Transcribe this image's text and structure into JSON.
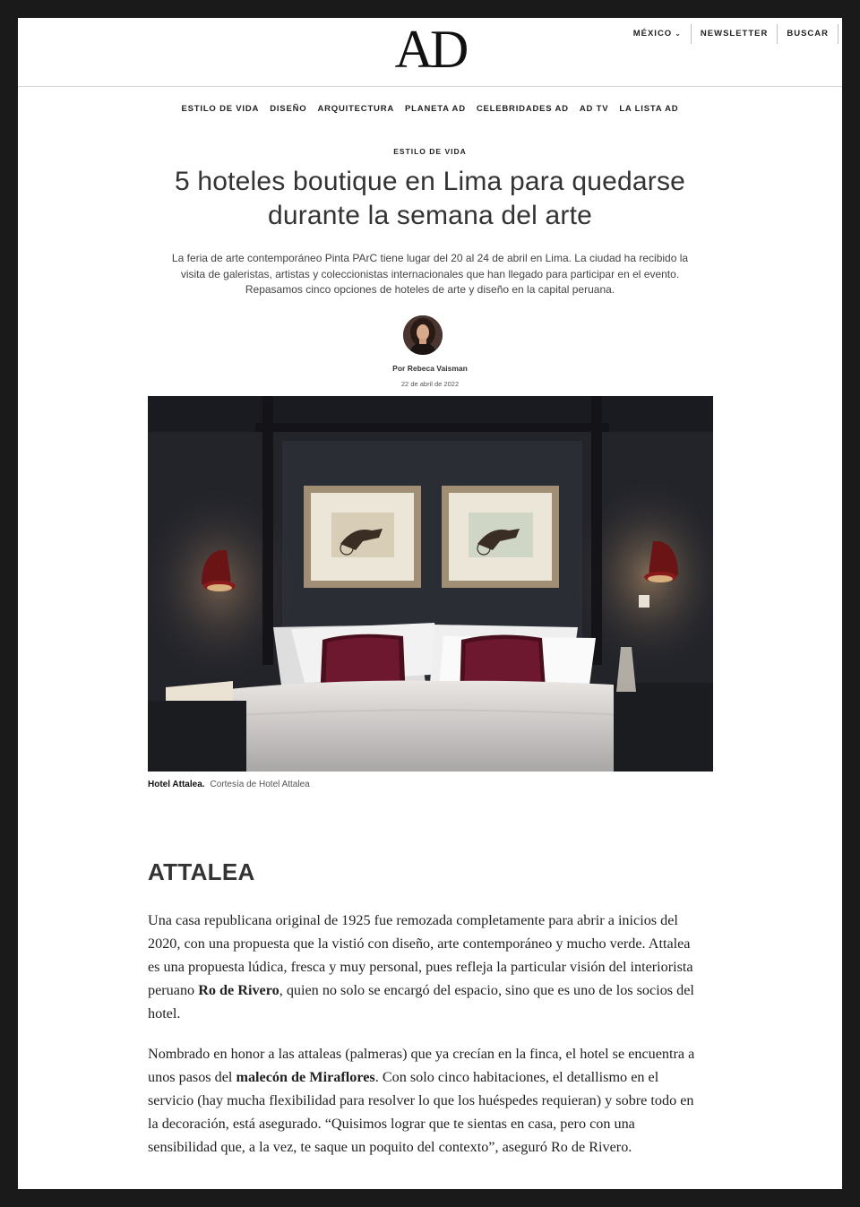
{
  "header": {
    "logo": "AD",
    "utility": [
      {
        "label": "MÉXICO",
        "has_chevron": true
      },
      {
        "label": "NEWSLETTER",
        "has_chevron": false
      },
      {
        "label": "BUSCAR",
        "has_chevron": false
      }
    ]
  },
  "nav": {
    "items": [
      "ESTILO DE VIDA",
      "DISEÑO",
      "ARQUITECTURA",
      "PLANETA AD",
      "CELEBRIDADES AD",
      "AD TV",
      "LA LISTA AD"
    ]
  },
  "article": {
    "kicker": "ESTILO DE VIDA",
    "headline_line1": "5 hoteles boutique en Lima para quedarse",
    "headline_line2": "durante la semana del arte",
    "dek_line1": "La feria de arte contemporáneo Pinta PArC tiene lugar del 20 al 24 de abril en Lima. La ciudad ha recibido la",
    "dek_line2": "visita de galeristas, artistas y coleccionistas internacionales que han llegado para participar en el evento.",
    "dek_line3": "Repasamos cinco opciones de hoteles de arte y diseño en la capital peruana.",
    "byline": "Por Rebeca Vaisman",
    "date": "22 de abril de 2022",
    "caption_title": "Hotel Attalea.",
    "caption_credit": "Cortesía de Hotel Attalea",
    "section_title": "ATTALEA",
    "p1": {
      "a": "Una casa republicana original de 1925 fue remozada completamente para abrir a inicios del 2020, con una propuesta que la vistió con diseño, arte contemporáneo y mucho verde. Attalea es una propuesta lúdica, fresca y muy personal, pues refleja la particular visión del interiorista peruano ",
      "bold": "Ro de Rivero",
      "b": ", quien no solo se encargó del espacio, sino que es uno de los socios del hotel."
    },
    "p2": {
      "a": "Nombrado en honor a las attaleas (palmeras) que ya crecían en la finca, el hotel se encuentra a unos pasos del ",
      "bold": "malecón de Miraflores",
      "b": ". Con solo cinco habitaciones, el detallismo en el servicio (hay mucha flexibilidad para resolver lo que los huéspedes requieran) y sobre todo en la decoración, está asegurado. “Quisimos lograr que te sientas en casa, pero con una sensibilidad que, a la vez, te saque un poquito del contexto”, aseguró Ro de Rivero."
    }
  },
  "colors": {
    "frame": "#1a1a1a",
    "wall": "#25262c",
    "pillow_accent": "#6e1830",
    "lamp_red": "#8a1a1c"
  }
}
